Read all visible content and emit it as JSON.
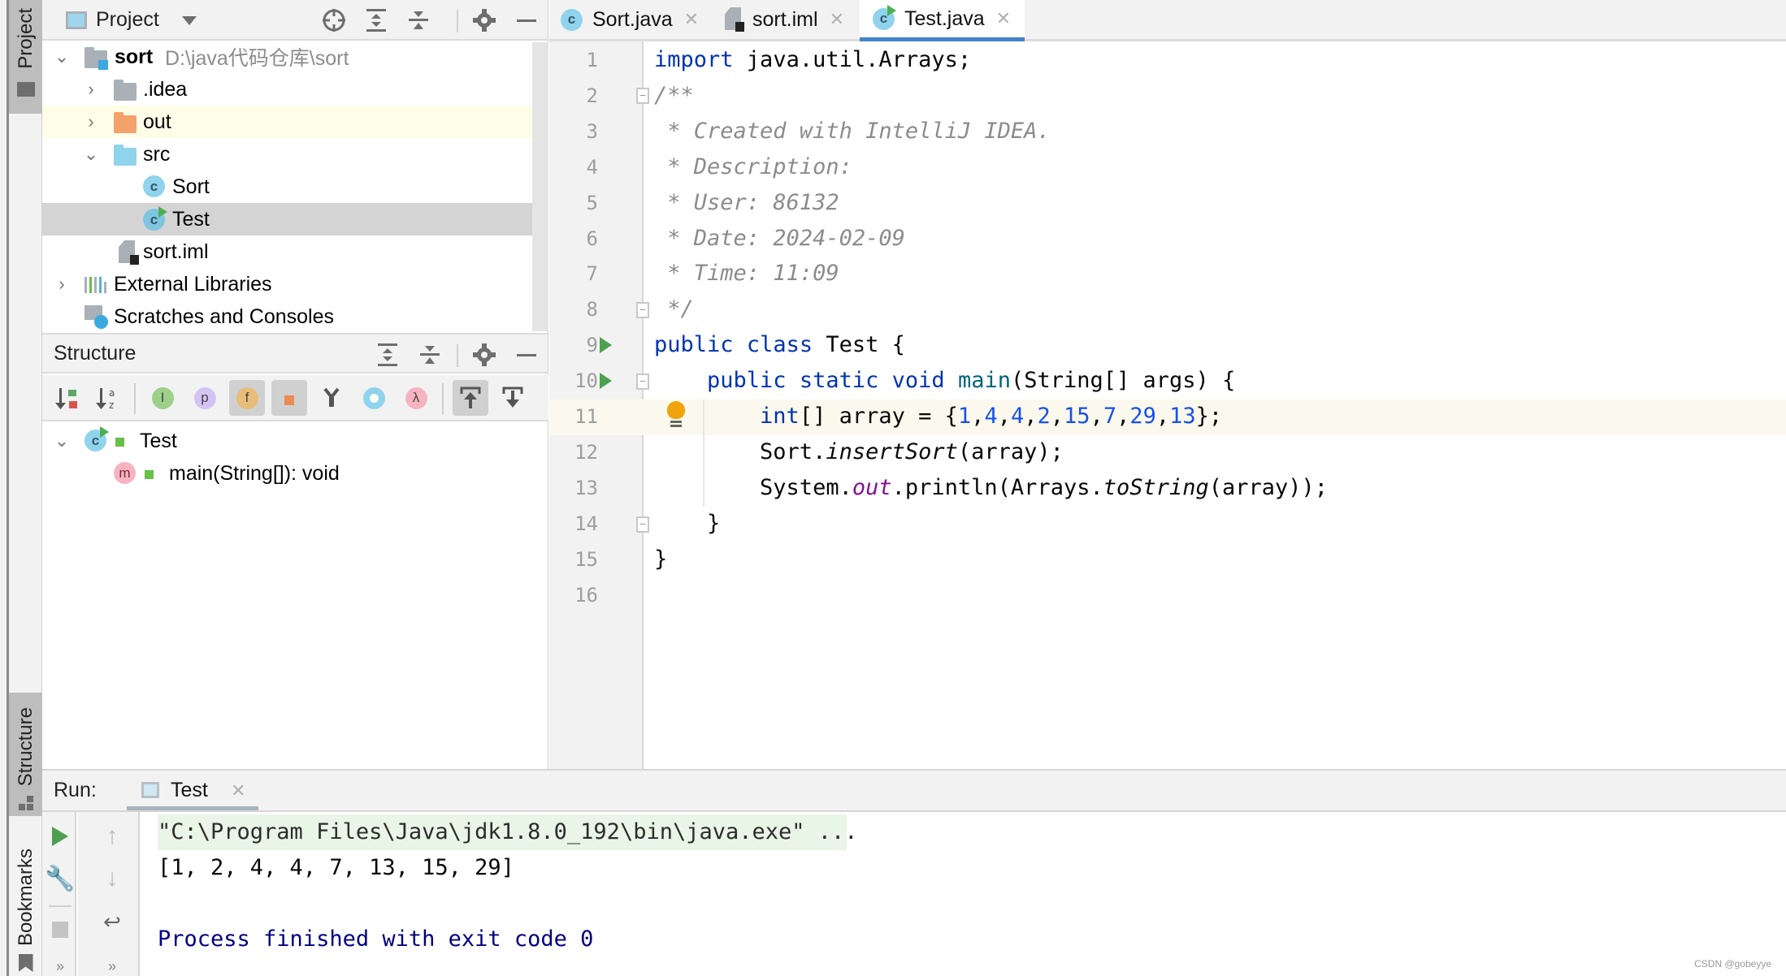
{
  "tool_strip": {
    "project_tab": "Project",
    "structure_tab": "Structure",
    "bookmarks_tab": "Bookmarks"
  },
  "project_panel": {
    "title": "Project",
    "header_icons": [
      "locate-icon",
      "expand-all-icon",
      "collapse-all-icon",
      "gear-icon",
      "minimize-icon"
    ],
    "tree": [
      {
        "label": "sort",
        "hint": "D:\\java代码仓库\\sort",
        "expanded": true,
        "type": "module"
      },
      {
        "label": ".idea",
        "expanded": false,
        "type": "folder"
      },
      {
        "label": "out",
        "expanded": false,
        "type": "folder-excluded"
      },
      {
        "label": "src",
        "expanded": true,
        "type": "folder-source"
      },
      {
        "label": "Sort",
        "type": "class"
      },
      {
        "label": "Test",
        "type": "class-runnable",
        "selected": true
      },
      {
        "label": "sort.iml",
        "type": "iml-file"
      },
      {
        "label": "External Libraries",
        "expanded": false,
        "type": "libraries"
      },
      {
        "label": "Scratches and Consoles",
        "type": "scratches"
      }
    ]
  },
  "structure_panel": {
    "title": "Structure",
    "toolbar": [
      {
        "name": "sort-by-visibility",
        "label": ""
      },
      {
        "name": "sort-alphabetically",
        "label": "a z"
      },
      {
        "name": "show-inherited",
        "label": "I"
      },
      {
        "name": "show-properties",
        "label": "p"
      },
      {
        "name": "show-fields",
        "label": "f",
        "active": true
      },
      {
        "name": "show-non-public",
        "label": "",
        "active": true
      },
      {
        "name": "show-lambdas-tree",
        "label": ""
      },
      {
        "name": "show-anonymous",
        "label": ""
      },
      {
        "name": "show-lambdas",
        "label": "λ"
      },
      {
        "name": "autoscroll-to-source",
        "label": "",
        "active": true
      },
      {
        "name": "autoscroll-from-source",
        "label": ""
      }
    ],
    "tree": [
      {
        "label": "Test",
        "type": "class"
      },
      {
        "label": "main(String[]): void",
        "type": "method",
        "badge": "m"
      }
    ]
  },
  "editor": {
    "tabs": [
      {
        "label": "Sort.java",
        "type": "class",
        "active": false
      },
      {
        "label": "sort.iml",
        "type": "iml",
        "active": false
      },
      {
        "label": "Test.java",
        "type": "class-runnable",
        "active": true
      }
    ],
    "current_line": 11,
    "lines": [
      "import java.util.Arrays;",
      "/**",
      " * Created with IntelliJ IDEA.",
      " * Description:",
      " * User: 86132",
      " * Date: 2024-02-09",
      " * Time: 11:09",
      " */",
      "public class Test {",
      "    public static void main(String[] args) {",
      "        int[] array = {1,4,4,2,15,7,29,13};",
      "        Sort.insertSort(array);",
      "        System.out.println(Arrays.toString(array));",
      "    }",
      "}",
      ""
    ]
  },
  "run_panel": {
    "label": "Run:",
    "tab": "Test",
    "console": [
      {
        "text": "\"C:\\Program Files\\Java\\jdk1.8.0_192\\bin\\java.exe\" ...",
        "kind": "command"
      },
      {
        "text": "[1, 2, 4, 4, 7, 13, 15, 29]",
        "kind": "output"
      },
      {
        "text": "",
        "kind": "blank"
      },
      {
        "text": "Process finished with exit code 0",
        "kind": "system"
      }
    ]
  },
  "watermark": "CSDN @gobeyye",
  "colors": {
    "accent_tab": "#4083c9",
    "keyword": "#0033b3",
    "number": "#1750eb",
    "comment": "#8c8c8c",
    "static_field": "#871094",
    "system_output": "#000080",
    "command_bg": "#e9f5e6"
  }
}
